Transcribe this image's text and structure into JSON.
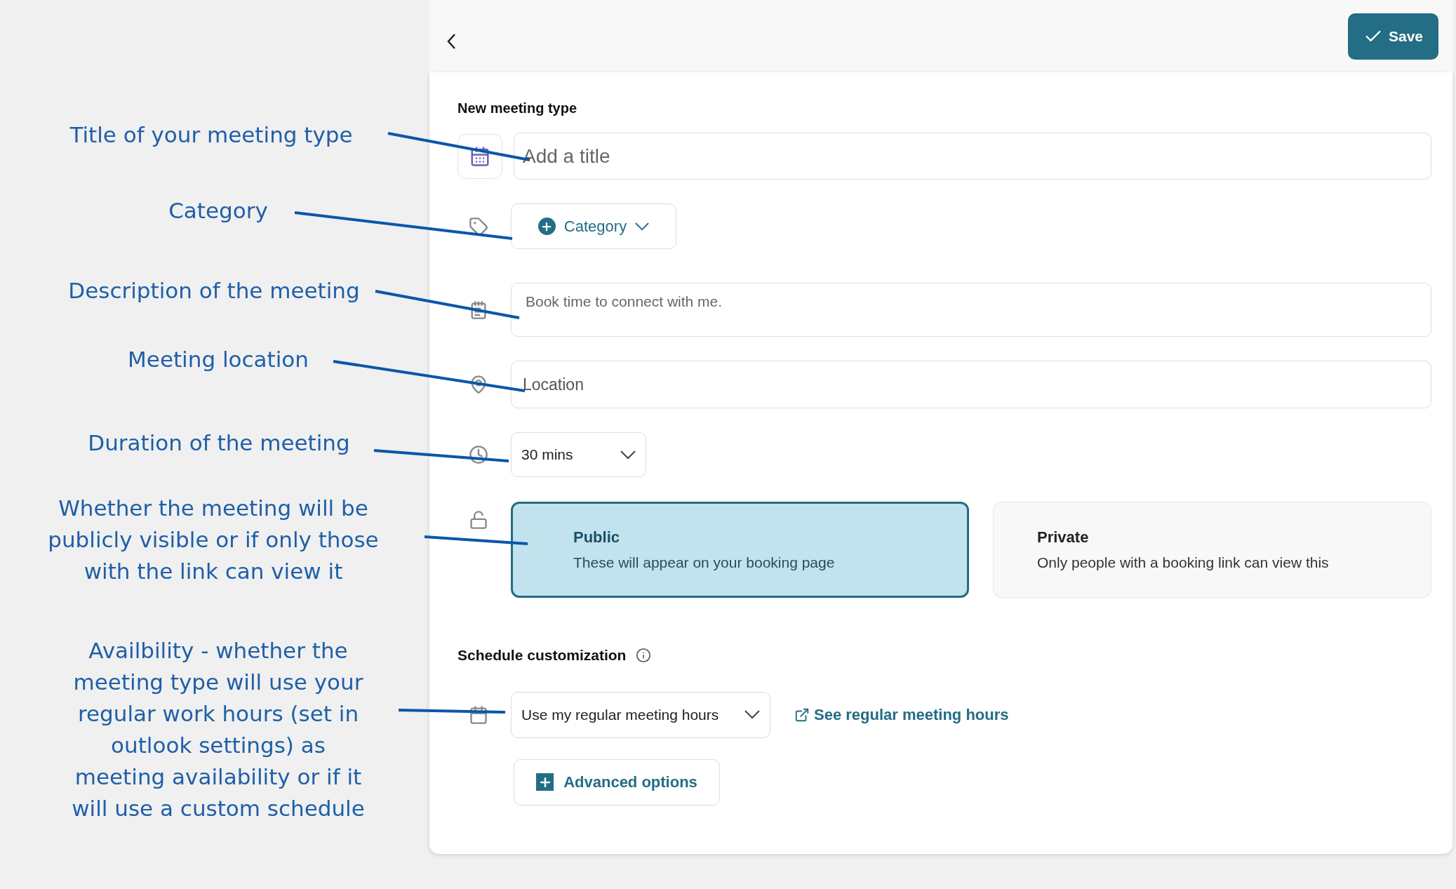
{
  "annotations": [
    {
      "text": "Title of your meeting type"
    },
    {
      "text": "Category"
    },
    {
      "text": "Description of the meeting"
    },
    {
      "text": "Meeting location"
    },
    {
      "text": "Duration of the meeting"
    },
    {
      "text": "Whether the meeting will be\npublicly visible or if only those\nwith the link can view it"
    },
    {
      "text": "Availbility - whether the\nmeeting type will use your\nregular work hours (set in\noutlook settings) as\nmeeting availability or if it\nwill use a custom schedule"
    }
  ],
  "header": {
    "save": "Save"
  },
  "form": {
    "heading": "New meeting type",
    "title_field": {
      "placeholder": "Add a title"
    },
    "category_button": "Category",
    "description_field": {
      "placeholder": "Book time to connect with me."
    },
    "location_field": {
      "placeholder": "Location"
    },
    "duration": "30 mins",
    "visibility": [
      {
        "title": "Public",
        "description": "These will appear on your booking page",
        "selected": true
      },
      {
        "title": "Private",
        "description": "Only people with a booking link can view this",
        "selected": false
      }
    ],
    "schedule_heading": "Schedule customization",
    "hours_dropdown": "Use my regular meeting hours",
    "hours_link": "See regular meeting hours",
    "advanced_button": "Advanced options"
  }
}
